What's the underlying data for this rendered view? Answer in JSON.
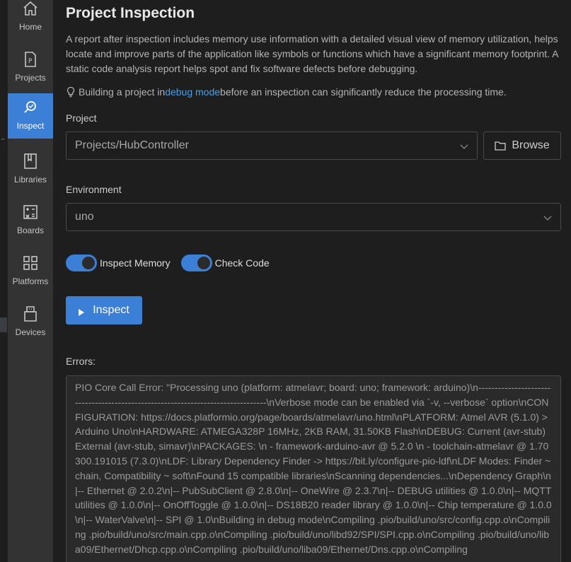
{
  "nav": {
    "items": [
      {
        "label": "Home",
        "icon": "home-icon"
      },
      {
        "label": "Projects",
        "icon": "projects-icon"
      },
      {
        "label": "Inspect",
        "icon": "inspect-icon",
        "active": true
      },
      {
        "label": "Libraries",
        "icon": "libraries-icon"
      },
      {
        "label": "Boards",
        "icon": "boards-icon"
      },
      {
        "label": "Platforms",
        "icon": "platforms-icon"
      },
      {
        "label": "Devices",
        "icon": "devices-icon"
      }
    ]
  },
  "page": {
    "title": "Project Inspection",
    "description": "A report after inspection includes memory use information with a detailed visual view of memory utilization, helps locate and improve parts of the application like symbols or functions which have a significant memory footprint. A static code analysis report helps spot and fix software defects before debugging.",
    "tip_before": "Building a project in ",
    "tip_link": "debug mode",
    "tip_after": " before an inspection can significantly reduce the processing time."
  },
  "project": {
    "label": "Project",
    "value": "Projects/HubController",
    "browse_label": "Browse"
  },
  "environment": {
    "label": "Environment",
    "value": "uno"
  },
  "toggles": {
    "inspect_memory": {
      "label": "Inspect Memory",
      "on": true
    },
    "check_code": {
      "label": "Check Code",
      "on": true
    }
  },
  "inspect_button": {
    "label": "Inspect"
  },
  "errors": {
    "label": "Errors:",
    "text": "PIO Core Call Error: \"Processing uno (platform: atmelavr; board: uno; framework: arduino)\\n--------------------------------------------------------------------------------\\nVerbose mode can be enabled via `-v, --verbose` option\\nCONFIGURATION: https://docs.platformio.org/page/boards/atmelavr/uno.html\\nPLATFORM: Atmel AVR (5.1.0) > Arduino Uno\\nHARDWARE: ATMEGA328P 16MHz, 2KB RAM, 31.50KB Flash\\nDEBUG: Current (avr-stub) External (avr-stub, simavr)\\nPACKAGES: \\n - framework-arduino-avr @ 5.2.0 \\n - toolchain-atmelavr @ 1.70300.191015 (7.3.0)\\nLDF: Library Dependency Finder -> https://bit.ly/configure-pio-ldf\\nLDF Modes: Finder ~ chain, Compatibility ~ soft\\nFound 15 compatible libraries\\nScanning dependencies...\\nDependency Graph\\n|-- Ethernet @ 2.0.2\\n|-- PubSubClient @ 2.8.0\\n|-- OneWire @ 2.3.7\\n|-- DEBUG utilities @ 1.0.0\\n|-- MQTT utilities @ 1.0.0\\n|-- OnOffToggle @ 1.0.0\\n|-- DS18B20 reader library @ 1.0.0\\n|-- Chip temperature @ 1.0.0\\n|-- WaterValve\\n|-- SPI @ 1.0\\nBuilding in debug mode\\nCompiling .pio/build/uno/src/config.cpp.o\\nCompiling .pio/build/uno/src/main.cpp.o\\nCompiling .pio/build/uno/libd92/SPI/SPI.cpp.o\\nCompiling .pio/build/uno/liba09/Ethernet/Dhcp.cpp.o\\nCompiling .pio/build/uno/liba09/Ethernet/Dns.cpp.o\\nCompiling"
  }
}
